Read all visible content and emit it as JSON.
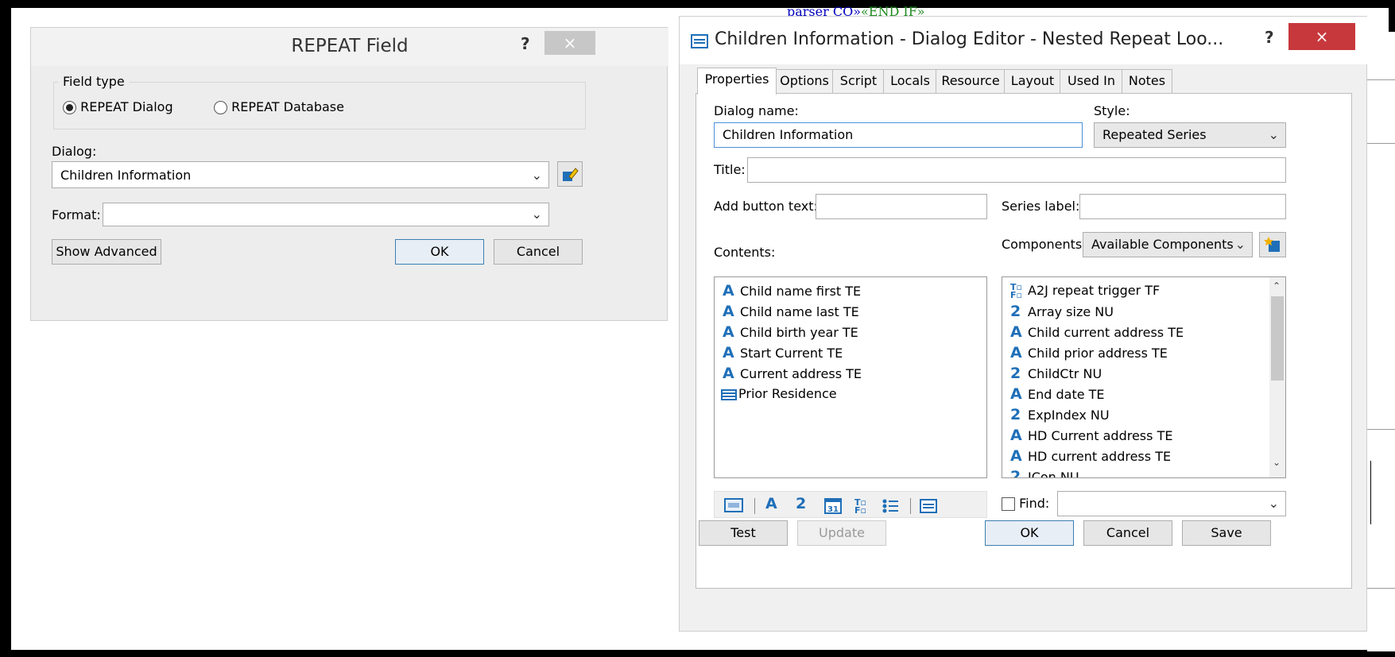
{
  "background_doc": {
    "top_text_blue": "parser CO»",
    "top_text_green": "«END IF»"
  },
  "repeat_dialog": {
    "title": "REPEAT Field",
    "help": "?",
    "close": "×",
    "field_type_legend": "Field type",
    "radio_dialog": "REPEAT Dialog",
    "radio_database": "REPEAT Database",
    "selected_radio": "REPEAT Dialog",
    "dialog_label": "Dialog:",
    "dialog_value": "Children Information",
    "format_label": "Format:",
    "format_value": "",
    "show_advanced": "Show Advanced",
    "ok": "OK",
    "cancel": "Cancel"
  },
  "dialog_editor": {
    "title": "Children Information - Dialog Editor - Nested Repeat Loo...",
    "help": "?",
    "close": "×",
    "tabs": [
      "Properties",
      "Options",
      "Script",
      "Locals",
      "Resource",
      "Layout",
      "Used In",
      "Notes"
    ],
    "active_tab": "Properties",
    "dialog_name_label": "Dialog name:",
    "dialog_name_value": "Children Information",
    "style_label": "Style:",
    "style_value": "Repeated Series",
    "title_label": "Title:",
    "title_value": "",
    "add_button_label": "Add button text:",
    "add_button_value": "",
    "series_label_label": "Series label:",
    "series_label_value": "",
    "contents_label": "Contents:",
    "components_label": "Components:",
    "components_value": "Available Components",
    "contents": [
      {
        "icon": "text-icon",
        "label": "Child name first TE"
      },
      {
        "icon": "text-icon",
        "label": "Child name last TE"
      },
      {
        "icon": "text-icon",
        "label": "Child birth year TE"
      },
      {
        "icon": "text-icon",
        "label": "Start Current TE"
      },
      {
        "icon": "text-icon",
        "label": "Current address TE"
      },
      {
        "icon": "dialog-icon",
        "label": "Prior Residence"
      }
    ],
    "components": [
      {
        "icon": "truefalse-icon",
        "label": "A2J repeat trigger TF"
      },
      {
        "icon": "number-icon",
        "label": "Array size NU"
      },
      {
        "icon": "text-icon",
        "label": "Child current address TE"
      },
      {
        "icon": "text-icon",
        "label": "Child prior address TE"
      },
      {
        "icon": "number-icon",
        "label": "ChildCtr NU"
      },
      {
        "icon": "text-icon",
        "label": "End date TE"
      },
      {
        "icon": "number-icon",
        "label": "ExpIndex NU"
      },
      {
        "icon": "text-icon",
        "label": "HD Current address TE"
      },
      {
        "icon": "text-icon",
        "label": "HD current address TE"
      },
      {
        "icon": "number-icon",
        "label": "ICon NU"
      }
    ],
    "find_label": "Find:",
    "find_value": "",
    "test": "Test",
    "update": "Update",
    "ok": "OK",
    "cancel": "Cancel",
    "save": "Save"
  }
}
